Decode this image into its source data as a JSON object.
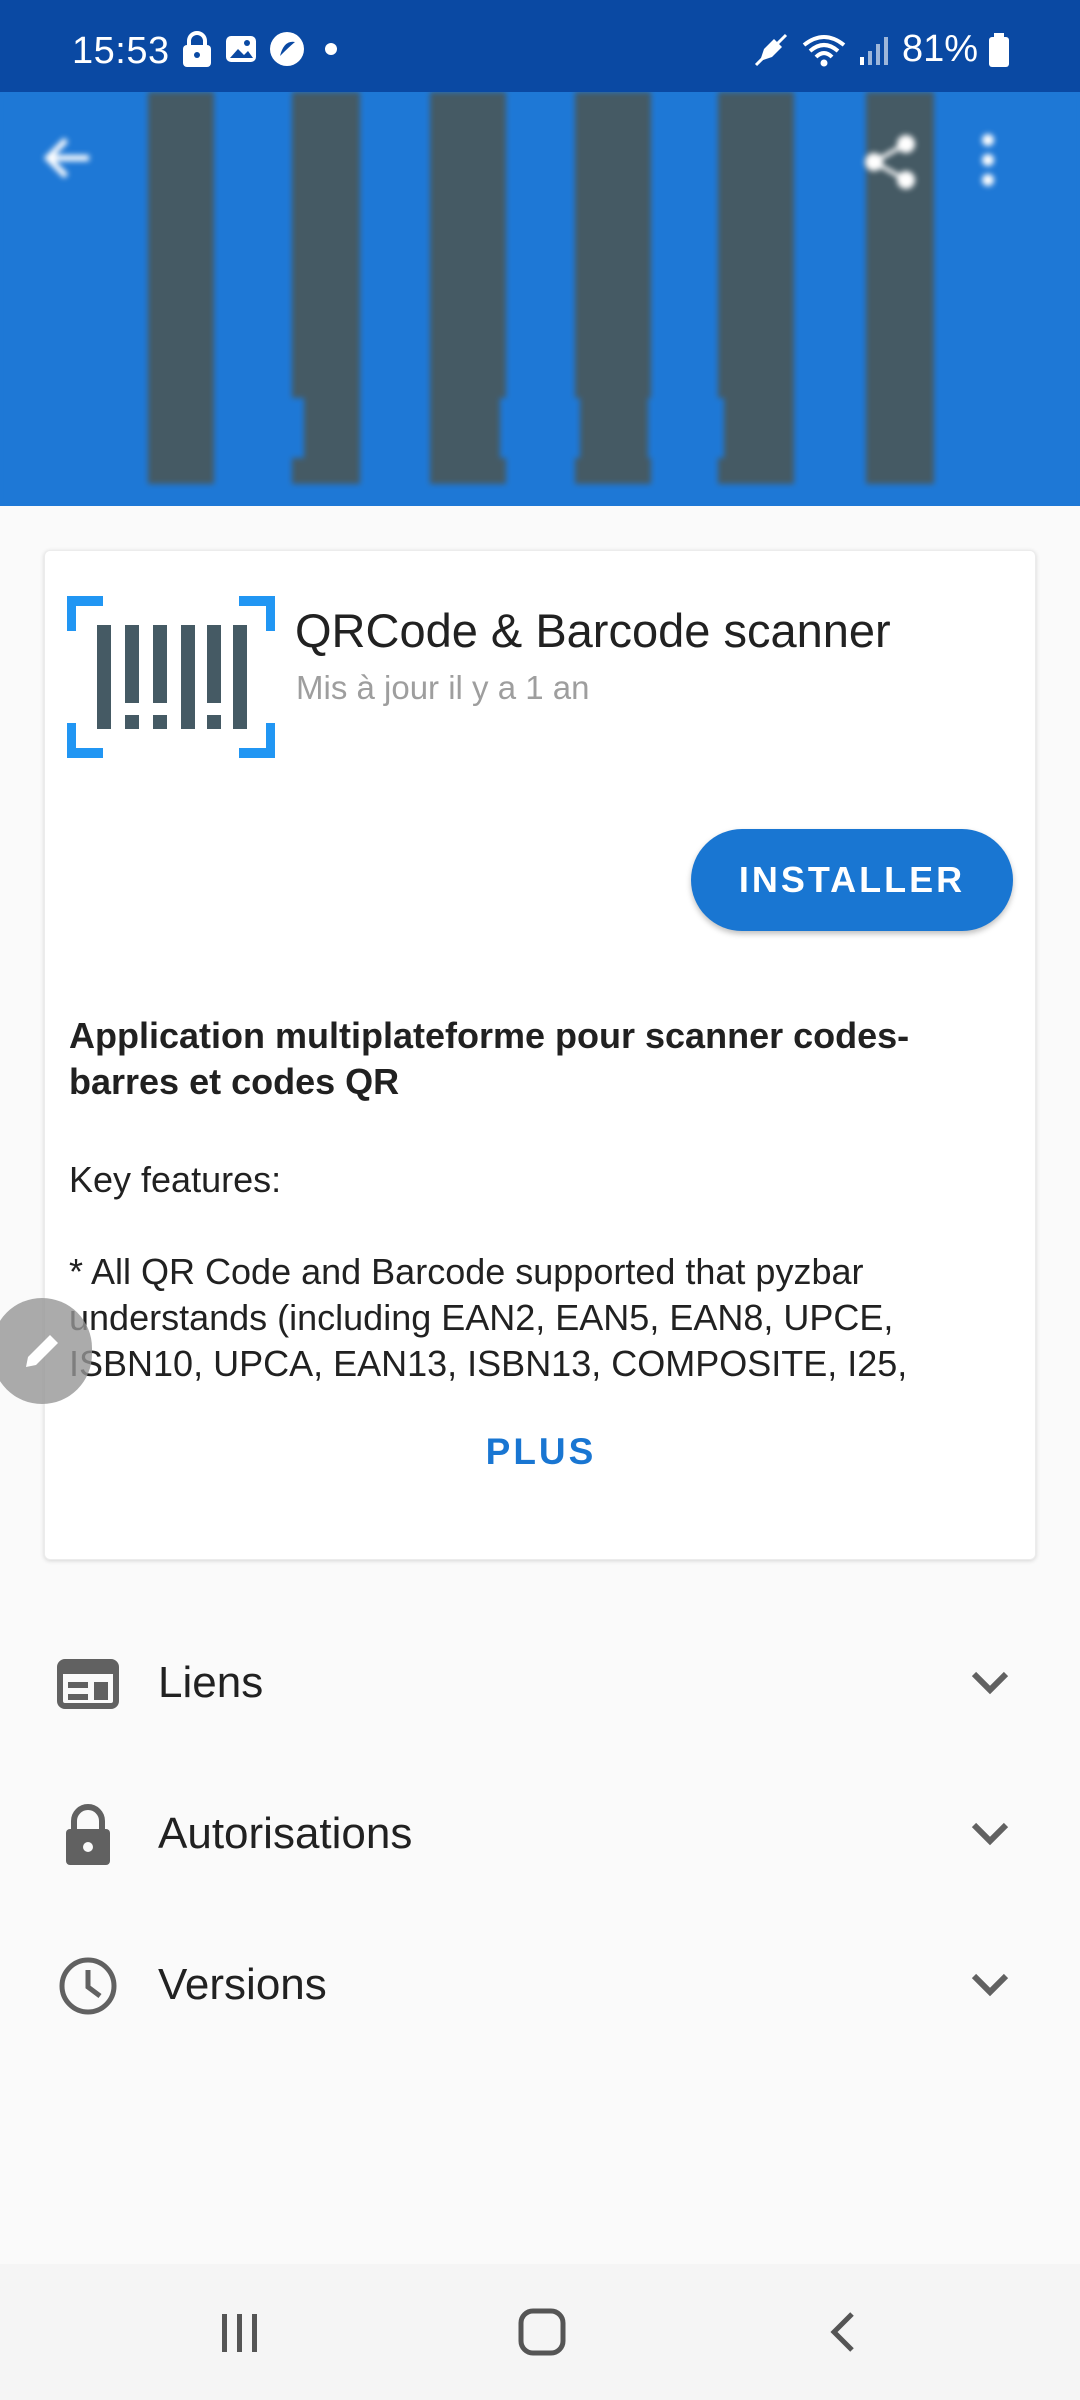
{
  "status_bar": {
    "time": "15:53",
    "battery": "81%",
    "left_icons": [
      "lock-icon",
      "image-icon",
      "browser-icon",
      "dot-icon"
    ],
    "right_icons": [
      "mute-icon",
      "wifi-icon",
      "signal-icon",
      "battery-icon"
    ]
  },
  "header": {
    "back_icon": "arrow-back-icon",
    "share_icon": "share-icon",
    "menu_icon": "more-vert-icon"
  },
  "app": {
    "title": "QRCode & Barcode scanner",
    "updated": "Mis à jour il y a 1 an",
    "install_label": "INSTALLER",
    "description_heading": "Application multiplateforme pour scanner codes-barres et codes QR",
    "description_body": "Key features:\n\n* All QR Code and Barcode supported that pyzbar understands (including EAN2, EAN5, EAN8, UPCE, ISBN10, UPCA, EAN13, ISBN13, COMPOSITE, I25,",
    "more_label": "PLUS"
  },
  "sections": [
    {
      "label": "Liens",
      "icon": "web-icon"
    },
    {
      "label": "Autorisations",
      "icon": "lock-icon"
    },
    {
      "label": "Versions",
      "icon": "clock-icon"
    }
  ],
  "colors": {
    "status_bar": "#0a49a3",
    "hero": "#1e78d6",
    "accent": "#1976d2",
    "bars": "#455a64"
  },
  "nav": {
    "recent_icon": "recent-apps-icon",
    "home_icon": "home-icon",
    "back_icon": "nav-back-icon"
  }
}
